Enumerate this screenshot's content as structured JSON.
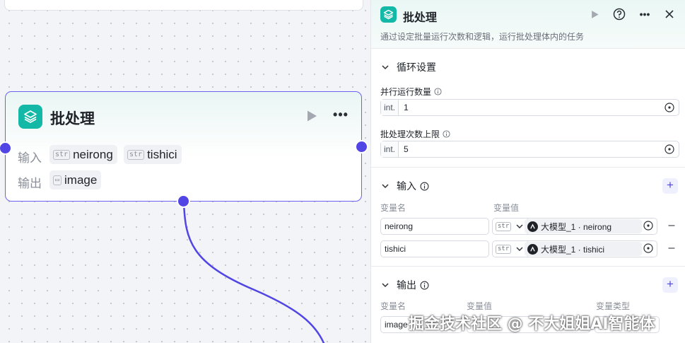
{
  "node": {
    "title": "批处理",
    "input_label": "输入",
    "output_label": "输出",
    "inputs": [
      {
        "type": "str",
        "name": "neirong"
      },
      {
        "type": "str",
        "name": "tishici"
      }
    ],
    "outputs": [
      {
        "type": "[img]",
        "name": "image"
      }
    ]
  },
  "panel": {
    "title": "批处理",
    "description": "通过设定批量运行次数和逻辑，运行批处理体内的任务",
    "loop_section": {
      "title": "循环设置",
      "parallel_label": "并行运行数量",
      "parallel_prefix": "int.",
      "parallel_value": "1",
      "limit_label": "批处理次数上限",
      "limit_prefix": "int.",
      "limit_value": "5"
    },
    "input_section": {
      "title": "输入",
      "col_name": "变量名",
      "col_value": "变量值",
      "rows": [
        {
          "name": "neirong",
          "type": "str",
          "ref": "大模型_1 · neirong"
        },
        {
          "name": "tishici",
          "type": "str",
          "ref": "大模型_1 · tishici"
        }
      ]
    },
    "output_section": {
      "title": "输出",
      "col_name": "变量名",
      "col_value": "变量值",
      "col_type": "变量类型",
      "first_row_name": "image"
    }
  },
  "watermark": "掘金技术社区 @ 不大姐姐AI智能体",
  "colors": {
    "accent": "#5146e5",
    "brand_teal": "#14b8a6"
  }
}
